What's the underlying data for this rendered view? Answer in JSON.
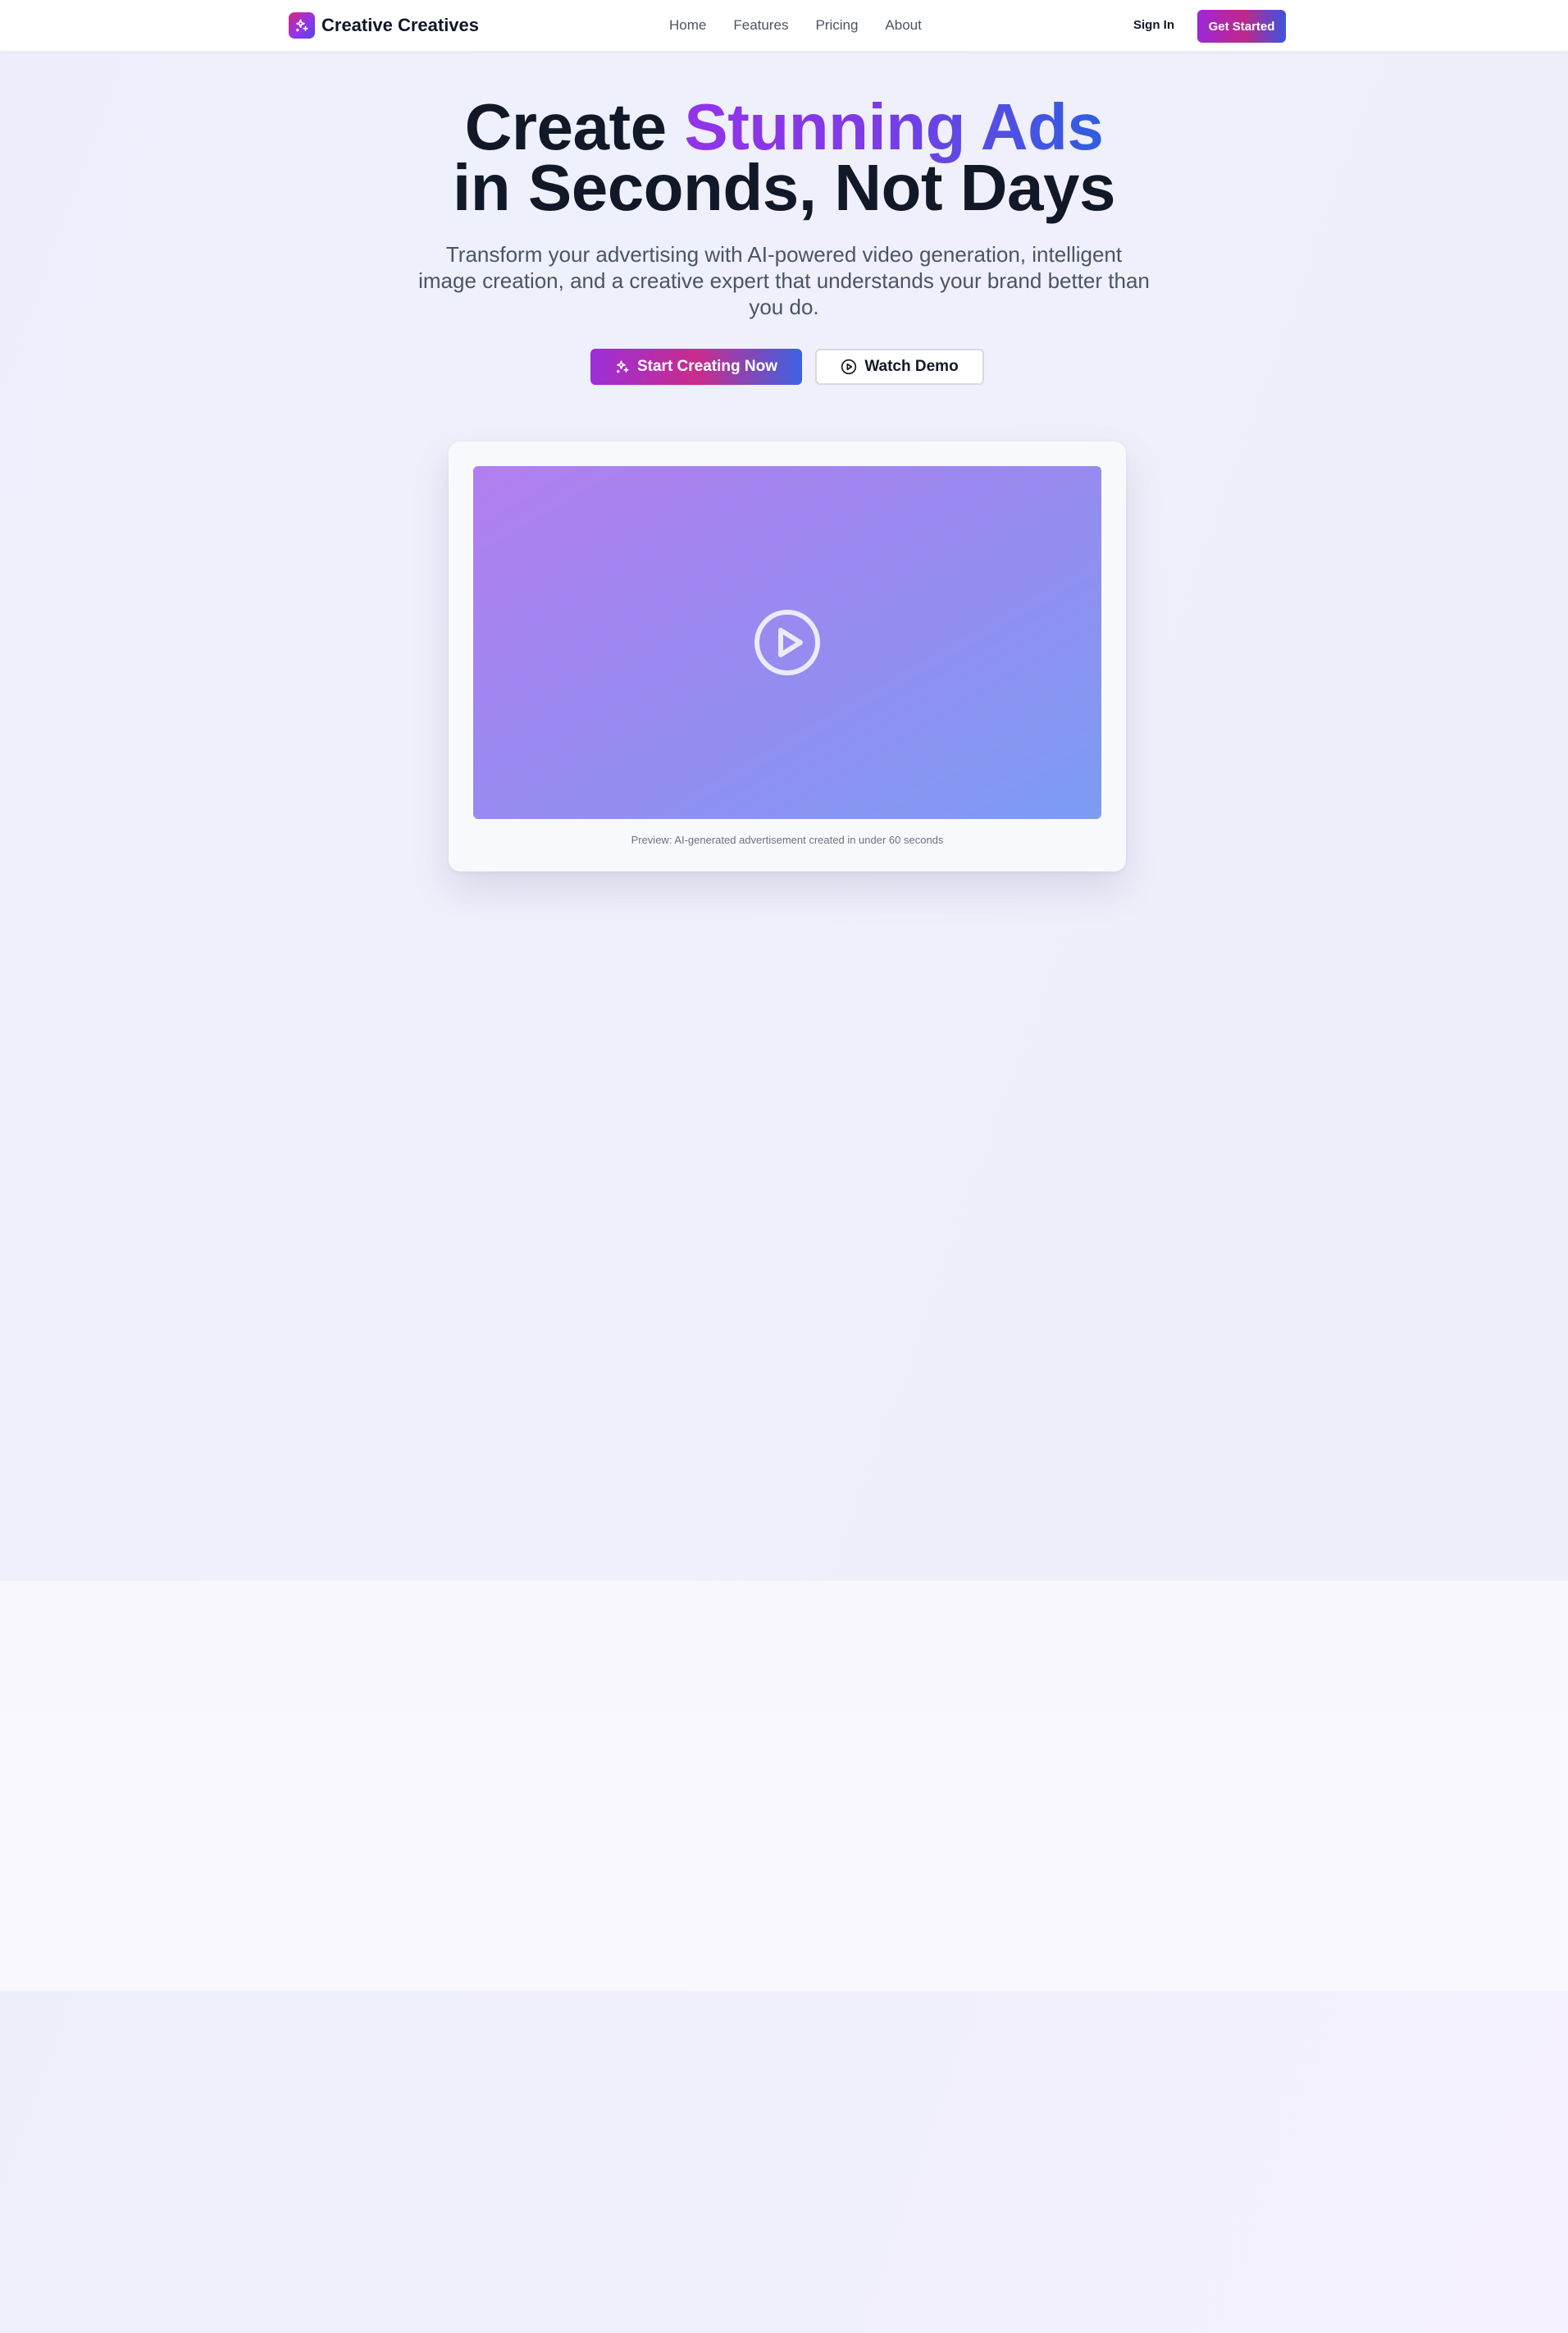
{
  "nav": {
    "brand": "Creative Creatives",
    "links": [
      "Home",
      "Features",
      "Pricing",
      "About"
    ],
    "sign_in": "Sign In",
    "get_started": "Get Started"
  },
  "hero": {
    "headline_part1": "Create ",
    "headline_highlight": "Stunning Ads",
    "headline_line2": "in Seconds, Not Days",
    "subtitle": "Transform your advertising with AI-powered video generation, intelligent image creation, and a creative expert that understands your brand better than you do.",
    "primary_cta": "Start Creating Now",
    "secondary_cta": "Watch Demo"
  },
  "preview": {
    "caption": "Preview: AI-generated advertisement created in under 60 seconds"
  },
  "icons": {
    "logo": "sparkles-icon",
    "primary_cta": "sparkles-icon",
    "secondary_cta": "play-circle-icon",
    "video": "play-circle-icon"
  },
  "colors": {
    "brand_gradient_start": "#9333ea",
    "brand_gradient_mid": "#db2777",
    "brand_gradient_end": "#3b63e2",
    "headline": "#111827",
    "body_text": "#4b5563"
  }
}
